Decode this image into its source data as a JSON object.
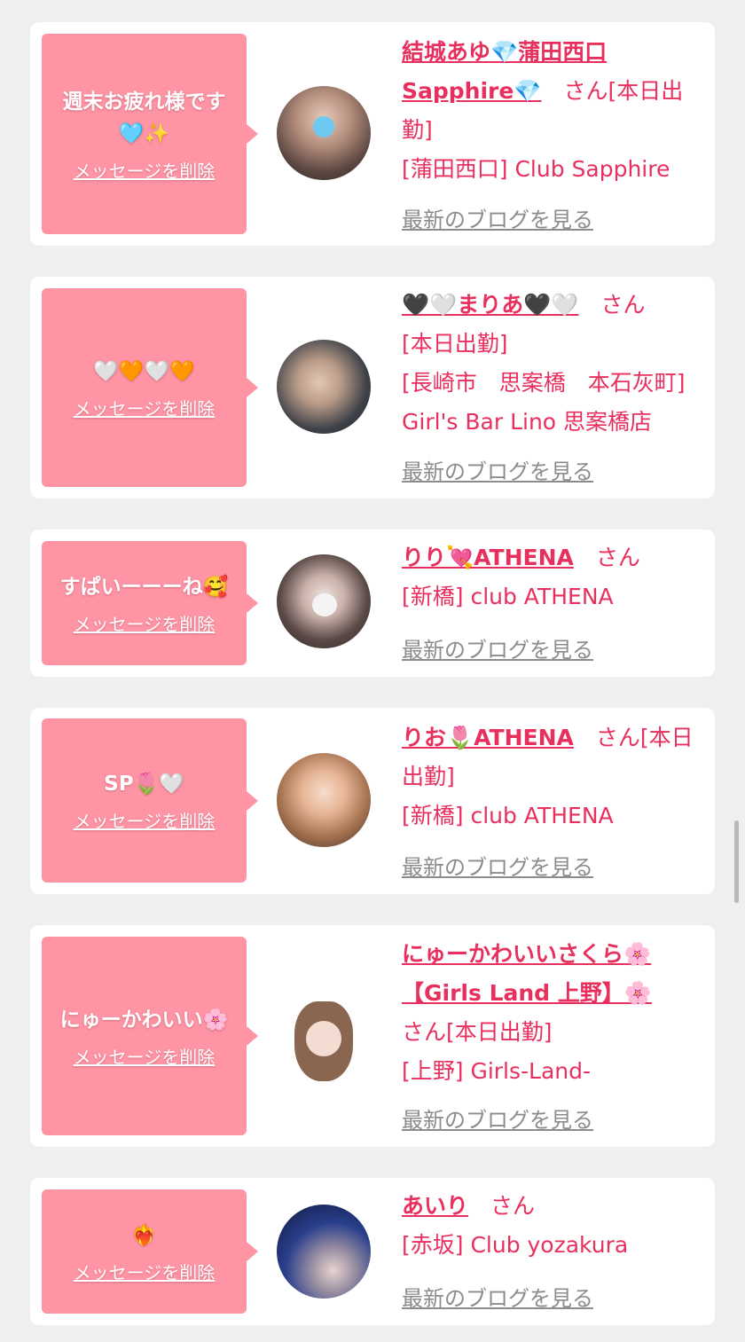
{
  "cards": [
    {
      "message": "週末お疲れ様です🩵✨",
      "delete_label": "メッセージを削除",
      "name": "結城あゆ💎蒲田西口Sapphire💎",
      "honorific": "さん",
      "status": "[本日出勤]",
      "shop": "[蒲田西口] Club Sapphire",
      "blog_label": "最新のブログを見る"
    },
    {
      "message": "🤍🧡🤍🧡",
      "delete_label": "メッセージを削除",
      "name": "🖤🤍まりあ🖤🤍",
      "honorific": "さん",
      "status": "[本日出勤]",
      "shop": "[長崎市　思案橋　本石灰町] Girl's Bar Lino 思案橋店",
      "blog_label": "最新のブログを見る"
    },
    {
      "message": "すぱいーーーね🥰",
      "delete_label": "メッセージを削除",
      "name": "りり💘ATHENA",
      "honorific": "さん",
      "status": "",
      "shop": "[新橋] club ATHENA",
      "blog_label": "最新のブログを見る"
    },
    {
      "message": "SP🌷🤍",
      "delete_label": "メッセージを削除",
      "name": "りお🌷ATHENA",
      "honorific": "さん",
      "status": "[本日出勤]",
      "shop": "[新橋] club ATHENA",
      "blog_label": "最新のブログを見る"
    },
    {
      "message": "にゅーかわいい🌸",
      "delete_label": "メッセージを削除",
      "name": "にゅーかわいいさくら🌸【Girls Land 上野】🌸",
      "honorific": "さん",
      "status": "[本日出勤]",
      "shop": "[上野] Girls-Land-",
      "blog_label": "最新のブログを見る"
    },
    {
      "message": "❤️‍🔥",
      "delete_label": "メッセージを削除",
      "name": "あいり",
      "honorific": "さん",
      "status": "",
      "shop": "[赤坂] Club yozakura",
      "blog_label": "最新のブログを見る"
    }
  ],
  "colors": {
    "bubble": "#fe94a4",
    "accent": "#e8305e",
    "link_gray": "#8c8c8c",
    "page_bg": "#efefef"
  }
}
